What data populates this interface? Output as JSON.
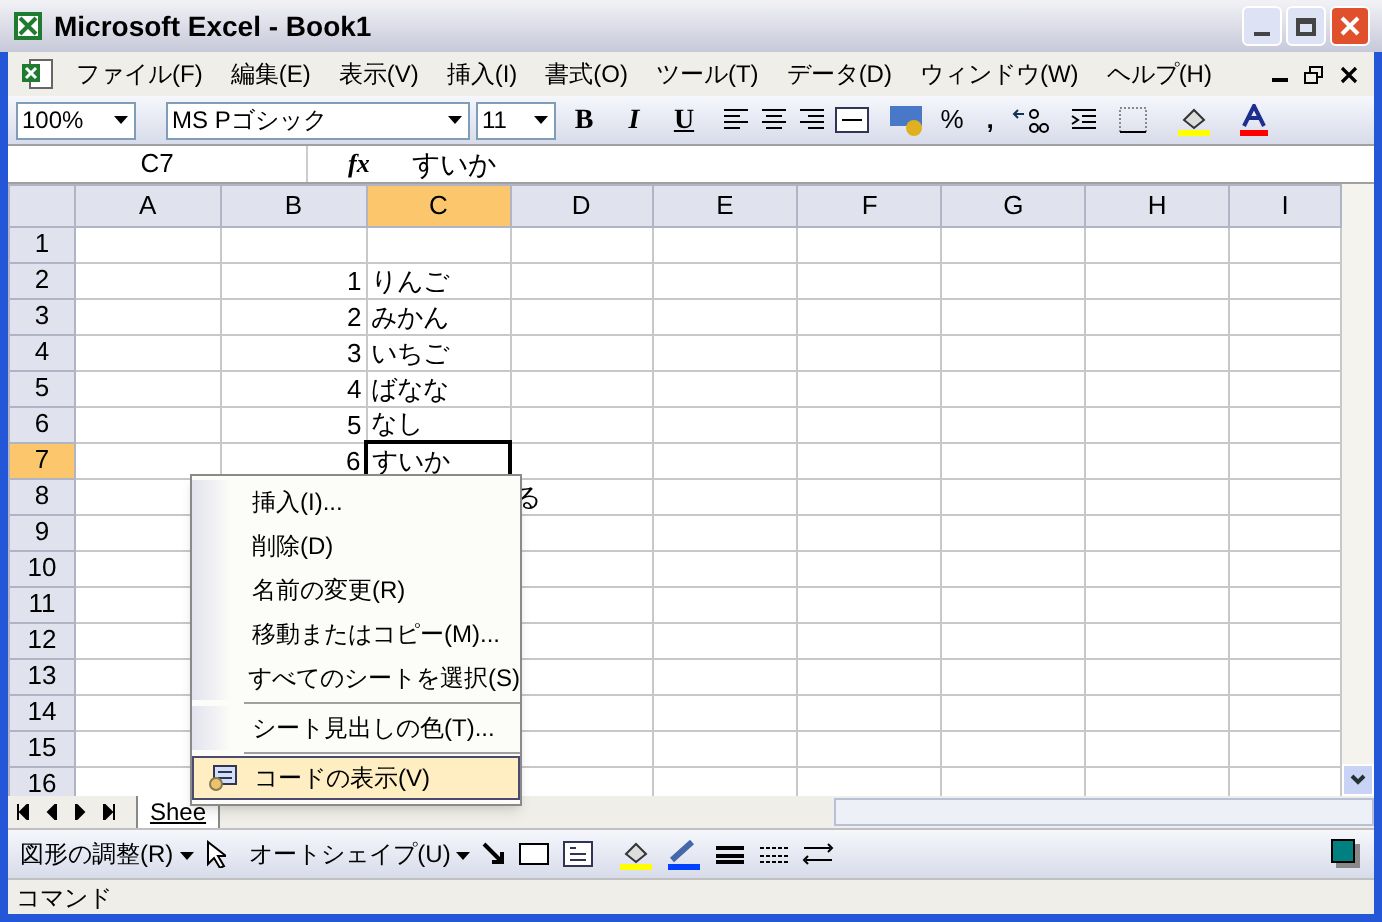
{
  "window": {
    "title": "Microsoft Excel - Book1"
  },
  "menu_bar": [
    "ファイル(F)",
    "編集(E)",
    "表示(V)",
    "挿入(I)",
    "書式(O)",
    "ツール(T)",
    "データ(D)",
    "ウィンドウ(W)",
    "ヘルプ(H)"
  ],
  "toolbar": {
    "zoom": "100%",
    "font": "MS Pゴシック",
    "size": "11",
    "bold": "B",
    "italic": "I",
    "underline": "U",
    "percent": "%",
    "comma": ","
  },
  "formula_bar": {
    "name_box": "C7",
    "fx": "fx",
    "value": "すいか"
  },
  "columns": [
    {
      "label": "A",
      "selected": false
    },
    {
      "label": "B",
      "selected": false
    },
    {
      "label": "C",
      "selected": true
    },
    {
      "label": "D",
      "selected": false
    },
    {
      "label": "E",
      "selected": false
    },
    {
      "label": "F",
      "selected": false
    },
    {
      "label": "G",
      "selected": false
    },
    {
      "label": "H",
      "selected": false
    },
    {
      "label": "I",
      "selected": false
    }
  ],
  "rows": [
    {
      "number": "1",
      "selected": false
    },
    {
      "number": "2",
      "selected": false,
      "cells": {
        "B": "1",
        "C": "りんご"
      }
    },
    {
      "number": "3",
      "selected": false,
      "cells": {
        "B": "2",
        "C": "みかん"
      }
    },
    {
      "number": "4",
      "selected": false,
      "cells": {
        "B": "3",
        "C": "いちご"
      }
    },
    {
      "number": "5",
      "selected": false,
      "cells": {
        "B": "4",
        "C": "ばなな"
      }
    },
    {
      "number": "6",
      "selected": false,
      "cells": {
        "B": "5",
        "C": "なし"
      }
    },
    {
      "number": "7",
      "selected": true,
      "cells": {
        "B": "6",
        "C": "すいか"
      }
    },
    {
      "number": "8",
      "selected": false,
      "cells": {
        "D": "る"
      }
    },
    {
      "number": "9",
      "selected": false
    },
    {
      "number": "10",
      "selected": false
    },
    {
      "number": "11",
      "selected": false
    },
    {
      "number": "12",
      "selected": false
    },
    {
      "number": "13",
      "selected": false
    },
    {
      "number": "14",
      "selected": false
    },
    {
      "number": "15",
      "selected": false
    },
    {
      "number": "16",
      "selected": false
    }
  ],
  "sheet_tabs": [
    {
      "label": "Shee",
      "selected": true
    }
  ],
  "context_menu": [
    {
      "kind": "item",
      "label": "挿入(I)...",
      "selected": false
    },
    {
      "kind": "item",
      "label": "削除(D)",
      "selected": false
    },
    {
      "kind": "item",
      "label": "名前の変更(R)",
      "selected": false
    },
    {
      "kind": "item",
      "label": "移動またはコピー(M)...",
      "selected": false
    },
    {
      "kind": "item",
      "label": "すべてのシートを選択(S)",
      "selected": false
    },
    {
      "kind": "separator"
    },
    {
      "kind": "item",
      "label": "シート見出しの色(T)...",
      "selected": false
    },
    {
      "kind": "separator"
    },
    {
      "kind": "item",
      "label": "コードの表示(V)",
      "selected": true,
      "icon": true
    }
  ],
  "drawing_toolbar": {
    "draw_menu": "図形の調整(R)",
    "autoshapes": "オートシェイプ(U)"
  },
  "status_bar": {
    "text": "コマンド"
  }
}
